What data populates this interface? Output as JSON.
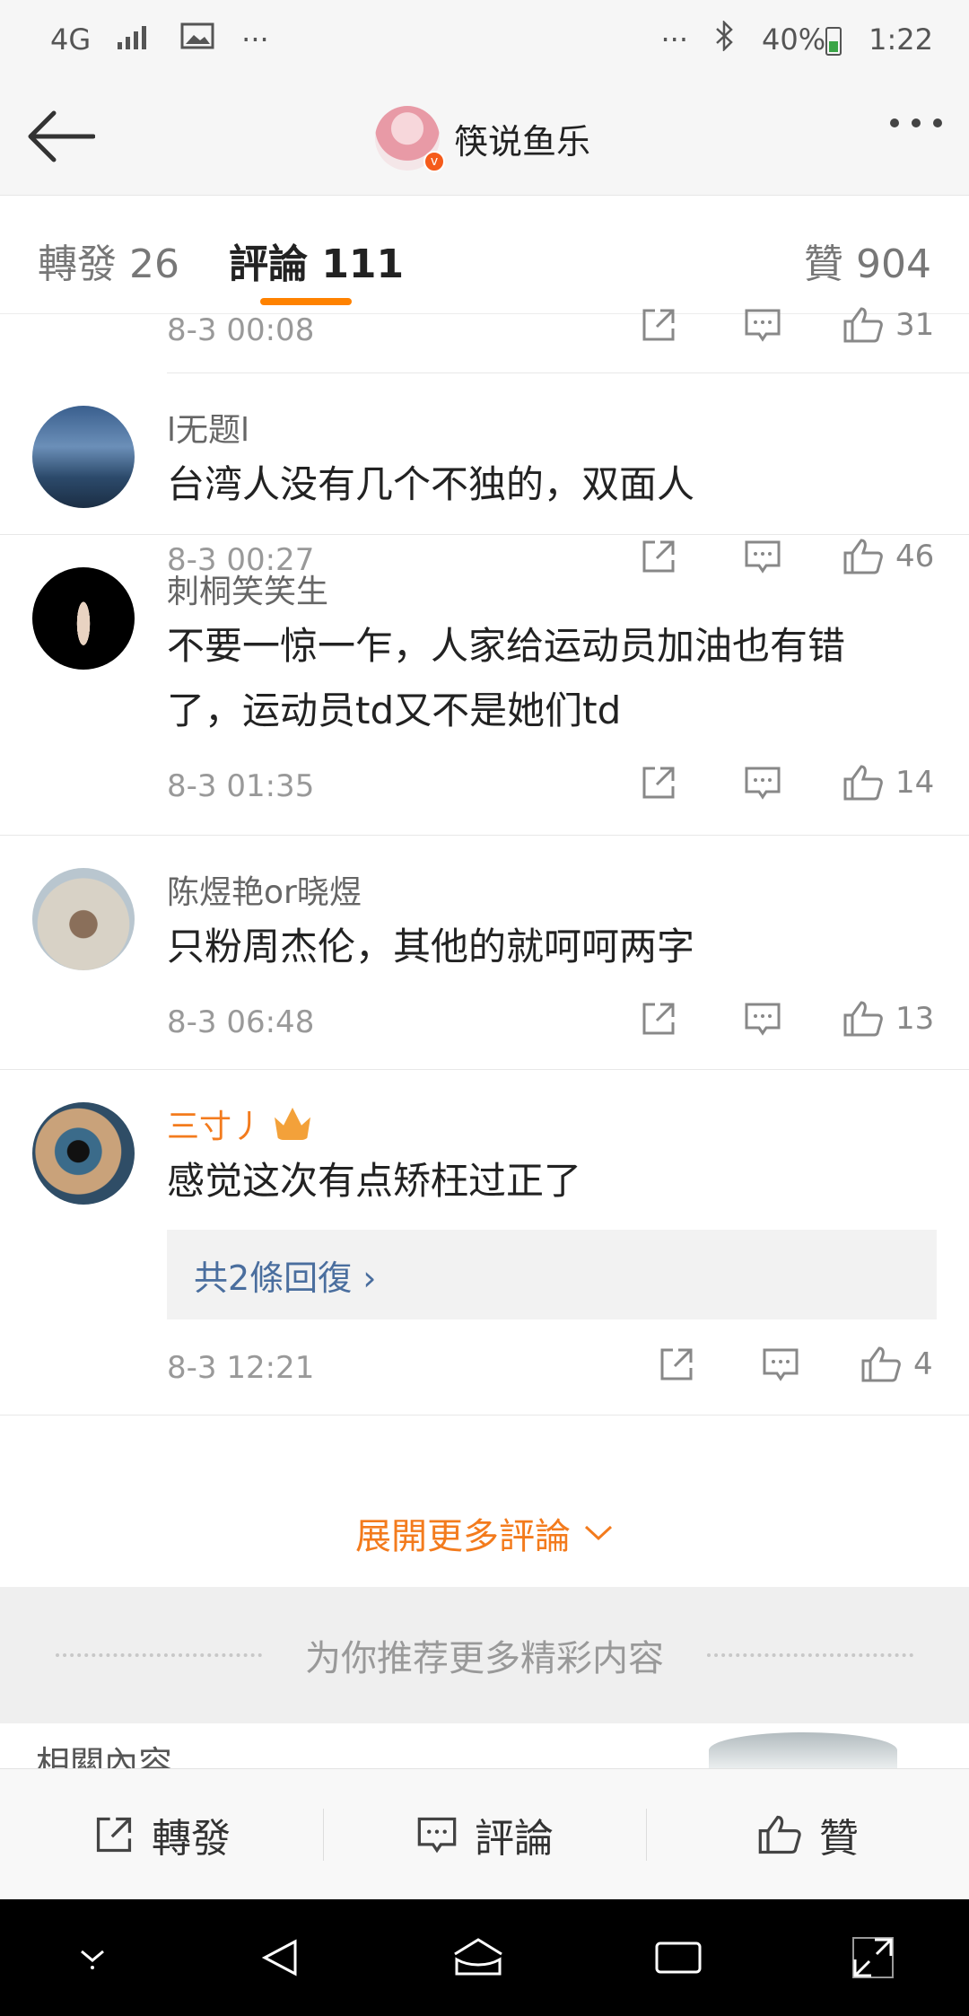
{
  "status_bar": {
    "network": "4G",
    "more": "···",
    "right_more": "···",
    "battery": "40%",
    "time": "1:22"
  },
  "header": {
    "user_name": "筷说鱼乐",
    "verified_mark": "v"
  },
  "tabs": {
    "repost": "轉發 26",
    "comments": "評論 111",
    "likes": "贊 904"
  },
  "top_partial": {
    "time": "8-3 00:08",
    "likes": "31"
  },
  "comments": [
    {
      "user": "l无题l",
      "text": "台湾人没有几个不独的，双面人",
      "time": "8-3 00:27",
      "likes": "46"
    },
    {
      "user": "刺桐笑笑生",
      "text": "不要一惊一乍，人家给运动员加油也有错了，运动员td又不是她们td",
      "time": "8-3 01:35",
      "likes": "14"
    },
    {
      "user": "陈煜艳or晓煜",
      "text": "只粉周杰伦，其他的就呵呵两字",
      "time": "8-3 06:48",
      "likes": "13"
    },
    {
      "user": "三寸丿",
      "text": "感觉这次有点矫枉过正了",
      "reply_link": "共2條回復 ›",
      "time": "8-3 12:21",
      "likes": "4"
    }
  ],
  "expand_more": "展開更多評論",
  "recommend": "为你推荐更多精彩内容",
  "peek_text": "相關內容",
  "actionbar": {
    "repost": "轉發",
    "comment": "評論",
    "like": "贊"
  },
  "colors": {
    "accent": "#ff8200",
    "link": "#4a6e9e"
  }
}
